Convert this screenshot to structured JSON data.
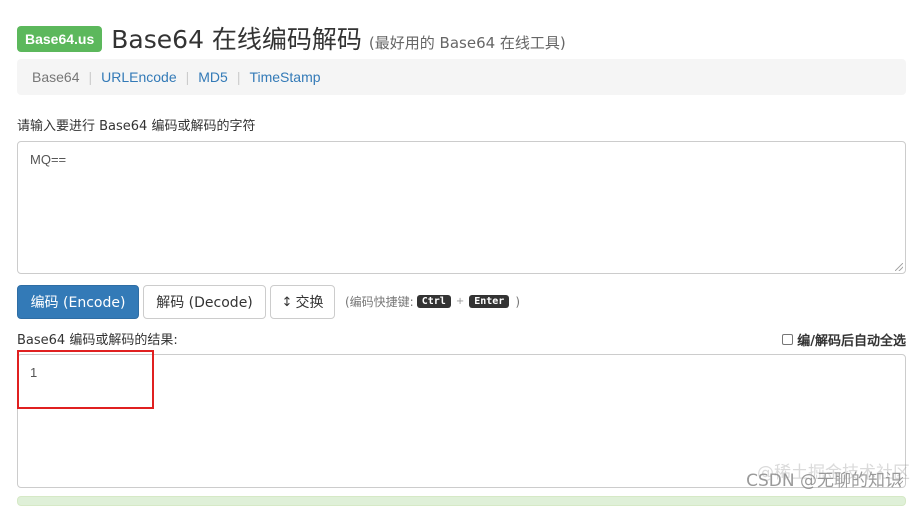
{
  "header": {
    "logo": "Base64.us",
    "title": "Base64 在线编码解码",
    "subtitle": "(最好用的 Base64 在线工具)"
  },
  "nav": {
    "items": [
      {
        "label": "Base64",
        "current": true
      },
      {
        "label": "URLEncode",
        "current": false
      },
      {
        "label": "MD5",
        "current": false
      },
      {
        "label": "TimeStamp",
        "current": false
      }
    ],
    "separator": "|"
  },
  "input": {
    "label": "请输入要进行 Base64 编码或解码的字符",
    "value": "MQ=="
  },
  "buttons": {
    "encode": "编码 (Encode)",
    "decode": "解码 (Decode)",
    "swap_icon": "↕",
    "swap": "交换"
  },
  "shortcut": {
    "prefix": "(编码快捷键:",
    "key1": "Ctrl",
    "plus": "+",
    "key2": "Enter",
    "suffix": ")"
  },
  "output": {
    "label": "Base64 编码或解码的结果:",
    "auto_select": "编/解码后自动全选",
    "auto_select_checked": false,
    "value": "1"
  },
  "watermark": {
    "main": "CSDN @无聊的知识",
    "shadow": "@稀土掘金技术社区"
  },
  "colors": {
    "logo_bg": "#5cb85c",
    "primary": "#337ab7",
    "highlight": "#e02020"
  }
}
